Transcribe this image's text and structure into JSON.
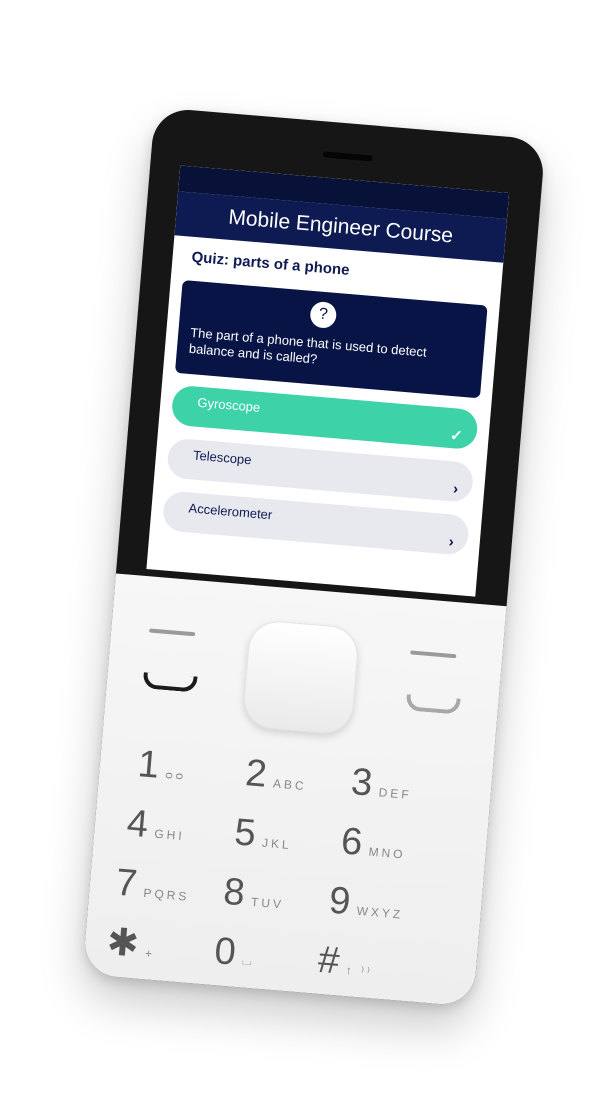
{
  "app": {
    "header_title": "Mobile Engineer Course",
    "quiz_title": "Quiz: parts of a phone"
  },
  "question": {
    "icon": "?",
    "text": "The part of a phone that is used to detect balance and is called?"
  },
  "answers": [
    {
      "label": "Gyroscope",
      "state": "correct",
      "marker": "✓"
    },
    {
      "label": "Telescope",
      "state": "default",
      "marker": "›"
    },
    {
      "label": "Accelerometer",
      "state": "default",
      "marker": "›"
    }
  ],
  "keypad": [
    {
      "digit": "1",
      "letters": "ᴑᴑ"
    },
    {
      "digit": "2",
      "letters": "ABC"
    },
    {
      "digit": "3",
      "letters": "DEF"
    },
    {
      "digit": "4",
      "letters": "GHI"
    },
    {
      "digit": "5",
      "letters": "JKL"
    },
    {
      "digit": "6",
      "letters": "MNO"
    },
    {
      "digit": "7",
      "letters": "PQRS"
    },
    {
      "digit": "8",
      "letters": "TUV"
    },
    {
      "digit": "9",
      "letters": "WXYZ"
    },
    {
      "digit": "✱",
      "letters": "+"
    },
    {
      "digit": "0",
      "letters": "⌴"
    },
    {
      "digit": "#",
      "letters": "↑ ⁾⁾"
    }
  ],
  "colors": {
    "header_bg": "#0e1a52",
    "question_bg": "#081445",
    "correct_answer": "#3dd2a8",
    "answer_bg": "#e8e9ef"
  }
}
